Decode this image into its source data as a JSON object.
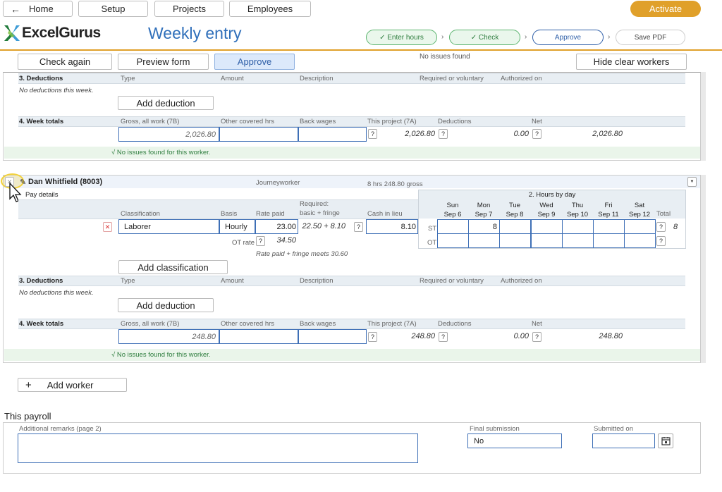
{
  "nav": {
    "home": "Home",
    "setup": "Setup",
    "projects": "Projects",
    "employees": "Employees",
    "activate": "Activate"
  },
  "brand": {
    "logo_text": "ExcelGurus",
    "page_title": "Weekly entry"
  },
  "steps": {
    "enter_hours": "✓ Enter hours",
    "check": "✓ Check",
    "approve": "Approve",
    "save_pdf": "Save PDF",
    "chevron": "›"
  },
  "toolbar": {
    "check_again": "Check again",
    "preview_form": "Preview form",
    "approve": "Approve",
    "status": "No issues found",
    "hide_clear": "Hide clear workers"
  },
  "sections": {
    "deductions": "3. Deductions",
    "week_totals": "4. Week totals",
    "pay_details": "Pay details",
    "hours_by_day": "2. Hours by day"
  },
  "deduction_cols": [
    "Type",
    "Amount",
    "Description",
    "Required or voluntary",
    "Authorized on"
  ],
  "totals_cols": [
    "Gross, all work (7B)",
    "Other covered hrs",
    "Back wages",
    "This project (7A)",
    "Deductions",
    "Net"
  ],
  "pay_cols": {
    "classification": "Classification",
    "basis": "Basis",
    "rate_paid": "Rate paid",
    "required_1": "Required:",
    "required_2": "basic + fringe",
    "cash": "Cash in lieu"
  },
  "days": [
    {
      "d": "Sun",
      "date": "Sep 6"
    },
    {
      "d": "Mon",
      "date": "Sep 7"
    },
    {
      "d": "Tue",
      "date": "Sep 8"
    },
    {
      "d": "Wed",
      "date": "Sep 9"
    },
    {
      "d": "Thu",
      "date": "Sep 10"
    },
    {
      "d": "Fri",
      "date": "Sep 11"
    },
    {
      "d": "Sat",
      "date": "Sep 12"
    }
  ],
  "total_label": "Total",
  "worker_a": {
    "no_deductions": "No deductions this week.",
    "add_deduction": "Add deduction",
    "gross": "2,026.80",
    "this_project": "2,026.80",
    "deductions": "0.00",
    "net": "2,026.80",
    "ok": "√  No issues found for this worker."
  },
  "worker_b": {
    "name": "Dan Whitfield (8003)",
    "role": "Journeyworker",
    "summary": "8 hrs   248.80 gross",
    "classification": "Laborer",
    "basis": "Hourly",
    "rate_paid": "23.00",
    "required": "22.50 + 8.10",
    "cash": "8.10",
    "ot_rate_label": "OT rate",
    "ot_rate": "34.50",
    "fringe_note": "Rate paid + fringe meets 30.60",
    "st_label": "ST",
    "ot_label": "OT",
    "mon_st": "8",
    "st_total": "8",
    "add_classification": "Add classification",
    "no_deductions": "No deductions this week.",
    "add_deduction": "Add deduction",
    "gross": "248.80",
    "this_project": "248.80",
    "deductions": "0.00",
    "net": "248.80",
    "ok": "√  No issues found for this worker."
  },
  "add_worker": "Add worker",
  "payroll": {
    "title": "This payroll",
    "remarks_label": "Additional remarks (page 2)",
    "final_label": "Final submission",
    "final_value": "No",
    "submitted_label": "Submitted on"
  },
  "qmark": "?",
  "remove_x": "✕",
  "plus": "+"
}
